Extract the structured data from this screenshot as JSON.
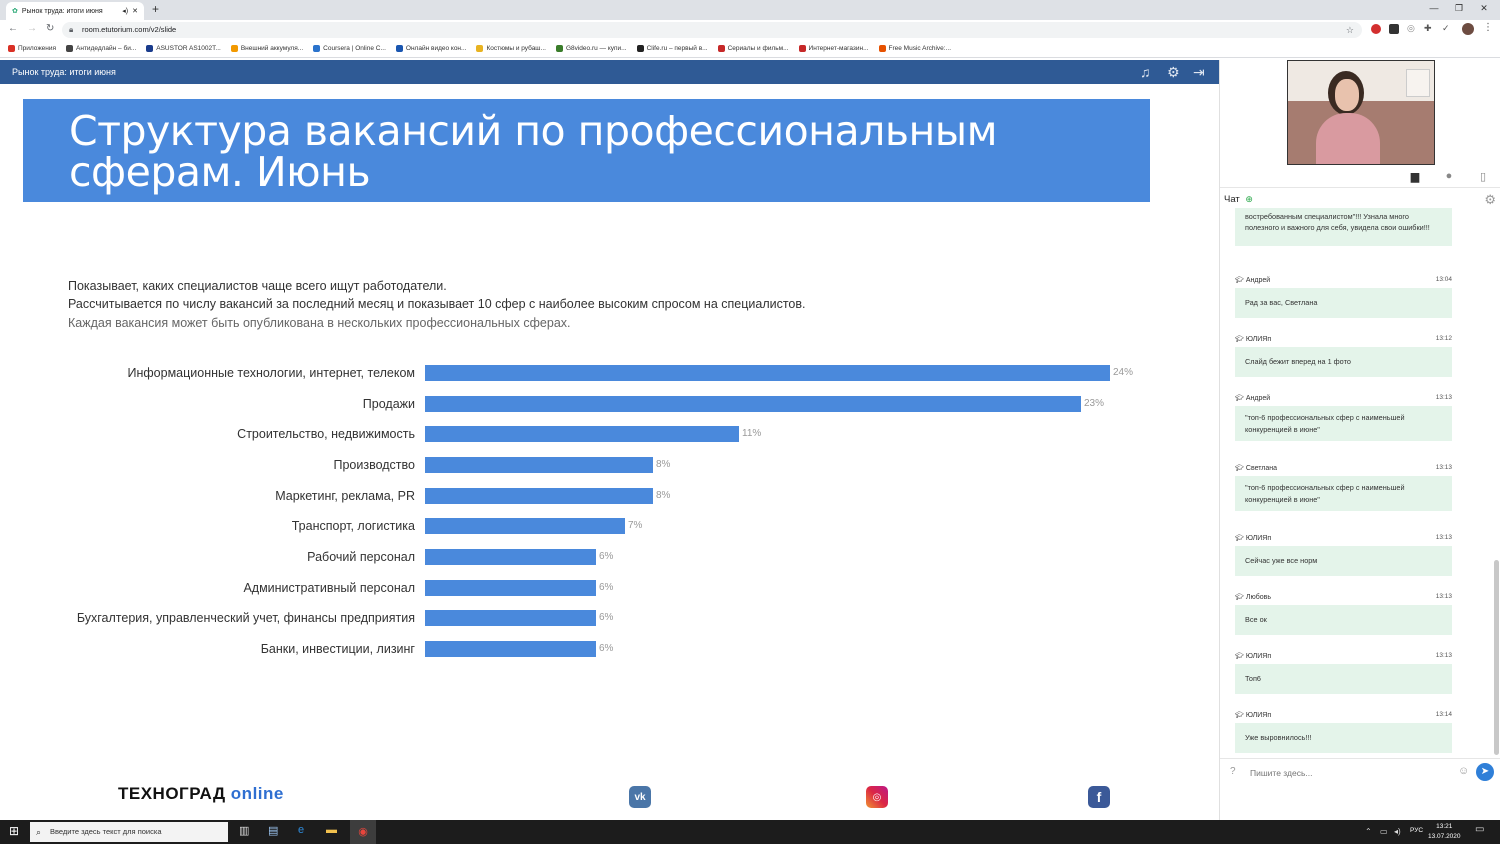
{
  "browser": {
    "tab_title": "Рынок труда: итоги июня",
    "url": "room.etutorium.com/v2/slide",
    "bookmarks": [
      {
        "label": "Приложения",
        "color": "#d93025"
      },
      {
        "label": "Антидедлайн – би...",
        "color": "#444"
      },
      {
        "label": "ASUSTOR AS1002T...",
        "color": "#1a3c8c"
      },
      {
        "label": "Внешний аккумуля...",
        "color": "#f29900"
      },
      {
        "label": "Coursera | Online C...",
        "color": "#2a73cc"
      },
      {
        "label": "Онлайн видео кон...",
        "color": "#1a56b0"
      },
      {
        "label": "Костюмы и рубаш...",
        "color": "#e8b321"
      },
      {
        "label": "G8video.ru — купи...",
        "color": "#3a7d2a"
      },
      {
        "label": "Clife.ru – первый в...",
        "color": "#222"
      },
      {
        "label": "Сериалы и фильм...",
        "color": "#c62828"
      },
      {
        "label": "Интернет-магазин...",
        "color": "#c62828"
      },
      {
        "label": "Free Music Archive:...",
        "color": "#e65100"
      }
    ]
  },
  "app": {
    "header_title": "Рынок труда: итоги июня"
  },
  "slide": {
    "title": "Структура вакансий по профессиональным сферам. Июнь",
    "desc_line1": "Показывает, каких специалистов чаще всего ищут работодатели.",
    "desc_line2": "Рассчитывается по числу вакансий за последний месяц и показывает 10 сфер с наиболее высоким спросом на специалистов.",
    "desc_line3": "Каждая вакансия может быть опубликована в нескольких профессиональных сферах.",
    "logo_text": "ТЕХНОГРАД",
    "logo_suffix": "online"
  },
  "chart_data": {
    "type": "bar",
    "orientation": "horizontal",
    "categories": [
      "Информационные технологии, интернет, телеком",
      "Продажи",
      "Строительство, недвижимость",
      "Производство",
      "Маркетинг, реклама, PR",
      "Транспорт, логистика",
      "Рабочий персонал",
      "Административный персонал",
      "Бухгалтерия, управленческий учет, финансы предприятия",
      "Банки, инвестиции, лизинг"
    ],
    "values": [
      24,
      23,
      11,
      8,
      8,
      7,
      6,
      6,
      6,
      6
    ],
    "value_labels": [
      "24%",
      "23%",
      "11%",
      "8%",
      "8%",
      "7%",
      "6%",
      "6%",
      "6%",
      "6%"
    ],
    "xlim": [
      0,
      24
    ],
    "bar_color": "#4a89dc"
  },
  "chat": {
    "title": "Чат",
    "input_placeholder": "Пишите здесь...",
    "messages": [
      {
        "author": "",
        "time": "",
        "text": "востребованным специалистом\"!!! Узнала много полезного и важного для себя, увидела свои ошибки!!!"
      },
      {
        "author": "Андрей",
        "time": "13:04",
        "text": "Рад за вас, Светлана"
      },
      {
        "author": "ЮЛИЯп",
        "time": "13:12",
        "text": "Слайд бежит вперед на 1 фото"
      },
      {
        "author": "Андрей",
        "time": "13:13",
        "text": "\"топ-6 профессиональных сфер с наименьшей конкуренцией в июне\""
      },
      {
        "author": "Светлана",
        "time": "13:13",
        "text": "\"топ-6 профессиональных сфер с наименьшей конкуренцией в июне\""
      },
      {
        "author": "ЮЛИЯп",
        "time": "13:13",
        "text": "Сейчас уже все норм"
      },
      {
        "author": "Любовь",
        "time": "13:13",
        "text": "Все ок"
      },
      {
        "author": "ЮЛИЯп",
        "time": "13:13",
        "text": "Топ6"
      },
      {
        "author": "ЮЛИЯп",
        "time": "13:14",
        "text": "Уже выровнилось!!!"
      }
    ]
  },
  "taskbar": {
    "search_placeholder": "Введите здесь текст для поиска",
    "lang": "РУС",
    "time": "13:21",
    "date": "13.07.2020"
  }
}
